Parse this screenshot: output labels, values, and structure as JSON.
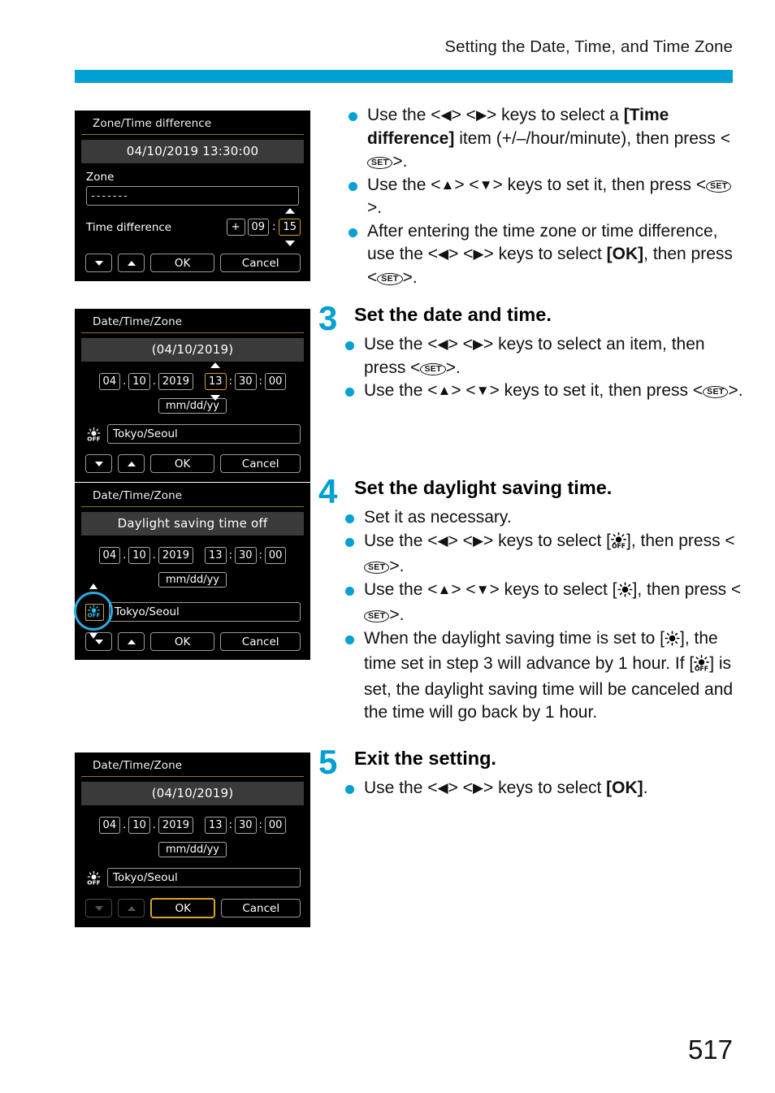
{
  "header": {
    "running_title": "Setting the Date, Time, and Time Zone",
    "rule_color": "#00a0d2"
  },
  "page_number": "517",
  "accent_color": "#00a0d2",
  "screens": [
    {
      "id": "zone-time-difference",
      "title": "Zone/Time difference",
      "banner": "04/10/2019 13:30:00",
      "zone_label": "Zone",
      "zone_value": "-------",
      "time_difference_label": "Time difference",
      "sign": "+",
      "hours": "09",
      "minutes": "15",
      "separator": ":",
      "selected_field": "minutes",
      "buttons": {
        "down": "▼",
        "up": "▲",
        "ok": "OK",
        "cancel": "Cancel"
      }
    },
    {
      "id": "date-time-zone-set-time",
      "title": "Date/Time/Zone",
      "banner": "(04/10/2019)",
      "month": "04",
      "day": "10",
      "year": "2019",
      "hour": "13",
      "minute": "30",
      "second": "00",
      "format": "mm/dd/yy",
      "timezone": "Tokyo/Seoul",
      "dst_icon": "dst-off-icon",
      "selected_field": "hour",
      "buttons": {
        "down": "▼",
        "up": "▲",
        "ok": "OK",
        "cancel": "Cancel"
      }
    },
    {
      "id": "date-time-zone-dst",
      "title": "Date/Time/Zone",
      "banner": "Daylight saving time off",
      "month": "04",
      "day": "10",
      "year": "2019",
      "hour": "13",
      "minute": "30",
      "second": "00",
      "format": "mm/dd/yy",
      "timezone": "Tokyo/Seoul",
      "dst_icon": "dst-off-icon",
      "selected_field": "dst",
      "buttons": {
        "down": "▼",
        "up": "▲",
        "ok": "OK",
        "cancel": "Cancel"
      }
    },
    {
      "id": "date-time-zone-exit",
      "title": "Date/Time/Zone",
      "banner": "(04/10/2019)",
      "month": "04",
      "day": "10",
      "year": "2019",
      "hour": "13",
      "minute": "30",
      "second": "00",
      "format": "mm/dd/yy",
      "timezone": "Tokyo/Seoul",
      "dst_icon": "dst-off-icon",
      "selected_field": "ok",
      "buttons": {
        "down": "▼",
        "up": "▲",
        "ok": "OK",
        "cancel": "Cancel"
      }
    }
  ],
  "intro_bullets": [
    {
      "parts": [
        {
          "t": "Use the <"
        },
        {
          "k": "left"
        },
        {
          "t": "> <"
        },
        {
          "k": "right"
        },
        {
          "t": "> keys to select a "
        },
        {
          "b": "[Time difference]"
        },
        {
          "t": " item (+/–/hour/minute), then press <"
        },
        {
          "k": "set"
        },
        {
          "t": ">."
        }
      ]
    },
    {
      "parts": [
        {
          "t": "Use the <"
        },
        {
          "k": "up"
        },
        {
          "t": "> <"
        },
        {
          "k": "down"
        },
        {
          "t": "> keys to set it, then press <"
        },
        {
          "k": "set"
        },
        {
          "t": ">."
        }
      ]
    },
    {
      "parts": [
        {
          "t": "After entering the time zone or time difference, use the <"
        },
        {
          "k": "left"
        },
        {
          "t": "> <"
        },
        {
          "k": "right"
        },
        {
          "t": "> keys to select "
        },
        {
          "b": "[OK]"
        },
        {
          "t": ", then press <"
        },
        {
          "k": "set"
        },
        {
          "t": ">."
        }
      ]
    }
  ],
  "steps": [
    {
      "number": "3",
      "heading": "Set the date and time.",
      "bullets": [
        {
          "parts": [
            {
              "t": "Use the <"
            },
            {
              "k": "left"
            },
            {
              "t": "> <"
            },
            {
              "k": "right"
            },
            {
              "t": "> keys to select an item, then press <"
            },
            {
              "k": "set"
            },
            {
              "t": ">."
            }
          ]
        },
        {
          "parts": [
            {
              "t": "Use the <"
            },
            {
              "k": "up"
            },
            {
              "t": "> <"
            },
            {
              "k": "down"
            },
            {
              "t": "> keys to set it, then press <"
            },
            {
              "k": "set"
            },
            {
              "t": ">."
            }
          ]
        }
      ]
    },
    {
      "number": "4",
      "heading": "Set the daylight saving time.",
      "bullets": [
        {
          "parts": [
            {
              "t": "Set it as necessary."
            }
          ]
        },
        {
          "parts": [
            {
              "t": "Use the <"
            },
            {
              "k": "left"
            },
            {
              "t": "> <"
            },
            {
              "k": "right"
            },
            {
              "t": "> keys to select ["
            },
            {
              "k": "sun-off"
            },
            {
              "t": "], then press <"
            },
            {
              "k": "set"
            },
            {
              "t": ">."
            }
          ]
        },
        {
          "parts": [
            {
              "t": "Use the <"
            },
            {
              "k": "up"
            },
            {
              "t": "> <"
            },
            {
              "k": "down"
            },
            {
              "t": "> keys to select ["
            },
            {
              "k": "sun-on"
            },
            {
              "t": "], then press <"
            },
            {
              "k": "set"
            },
            {
              "t": ">."
            }
          ]
        },
        {
          "parts": [
            {
              "t": "When the daylight saving time is set to ["
            },
            {
              "k": "sun-on"
            },
            {
              "t": "], the time set in step 3 will advance by 1 hour. If ["
            },
            {
              "k": "sun-off"
            },
            {
              "t": "] is set, the daylight saving time will be canceled and the time will go back by 1 hour."
            }
          ]
        }
      ]
    },
    {
      "number": "5",
      "heading": "Exit the setting.",
      "bullets": [
        {
          "parts": [
            {
              "t": "Use the <"
            },
            {
              "k": "left"
            },
            {
              "t": "> <"
            },
            {
              "k": "right"
            },
            {
              "t": "> keys to select "
            },
            {
              "b": "[OK]"
            },
            {
              "t": "."
            }
          ]
        }
      ]
    }
  ]
}
